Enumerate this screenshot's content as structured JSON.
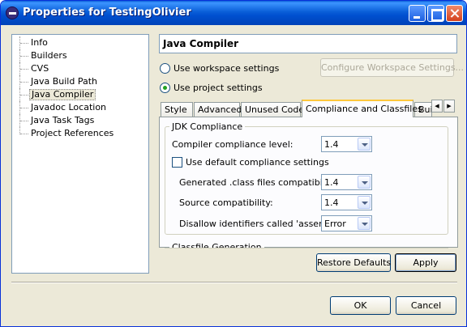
{
  "window": {
    "title": "Properties for TestingOlivier",
    "minimize": "minimize",
    "maximize": "maximize",
    "close": "close"
  },
  "tree": {
    "items": [
      {
        "label": "Info",
        "selected": false
      },
      {
        "label": "Builders",
        "selected": false
      },
      {
        "label": "CVS",
        "selected": false
      },
      {
        "label": "Java Build Path",
        "selected": false
      },
      {
        "label": "Java Compiler",
        "selected": true
      },
      {
        "label": "Javadoc Location",
        "selected": false
      },
      {
        "label": "Java Task Tags",
        "selected": false
      },
      {
        "label": "Project References",
        "selected": false
      }
    ]
  },
  "page": {
    "heading": "Java Compiler",
    "use_workspace_label": "Use workspace settings",
    "use_project_label": "Use project settings",
    "selected_scope": "project",
    "configure_button": "Configure Workspace Settings...",
    "configure_enabled": false
  },
  "tabs": {
    "items": [
      "Style",
      "Advanced",
      "Unused Code",
      "Compliance and Classfiles",
      "Buil"
    ],
    "active": "Compliance and Classfiles"
  },
  "compliance": {
    "group_title": "JDK Compliance",
    "level_label": "Compiler compliance level:",
    "level_value": "1.4",
    "use_default_label": "Use default compliance settings",
    "use_default_checked": false,
    "generated_label": "Generated .class files compatibility:",
    "generated_value": "1.4",
    "source_label": "Source compatibility:",
    "source_value": "1.4",
    "assert_label": "Disallow identifiers called 'assert':",
    "assert_value": "Error"
  },
  "classfile": {
    "group_title": "Classfile Generation"
  },
  "buttons": {
    "restore_defaults": "Restore Defaults",
    "apply": "Apply",
    "ok": "OK",
    "cancel": "Cancel"
  }
}
